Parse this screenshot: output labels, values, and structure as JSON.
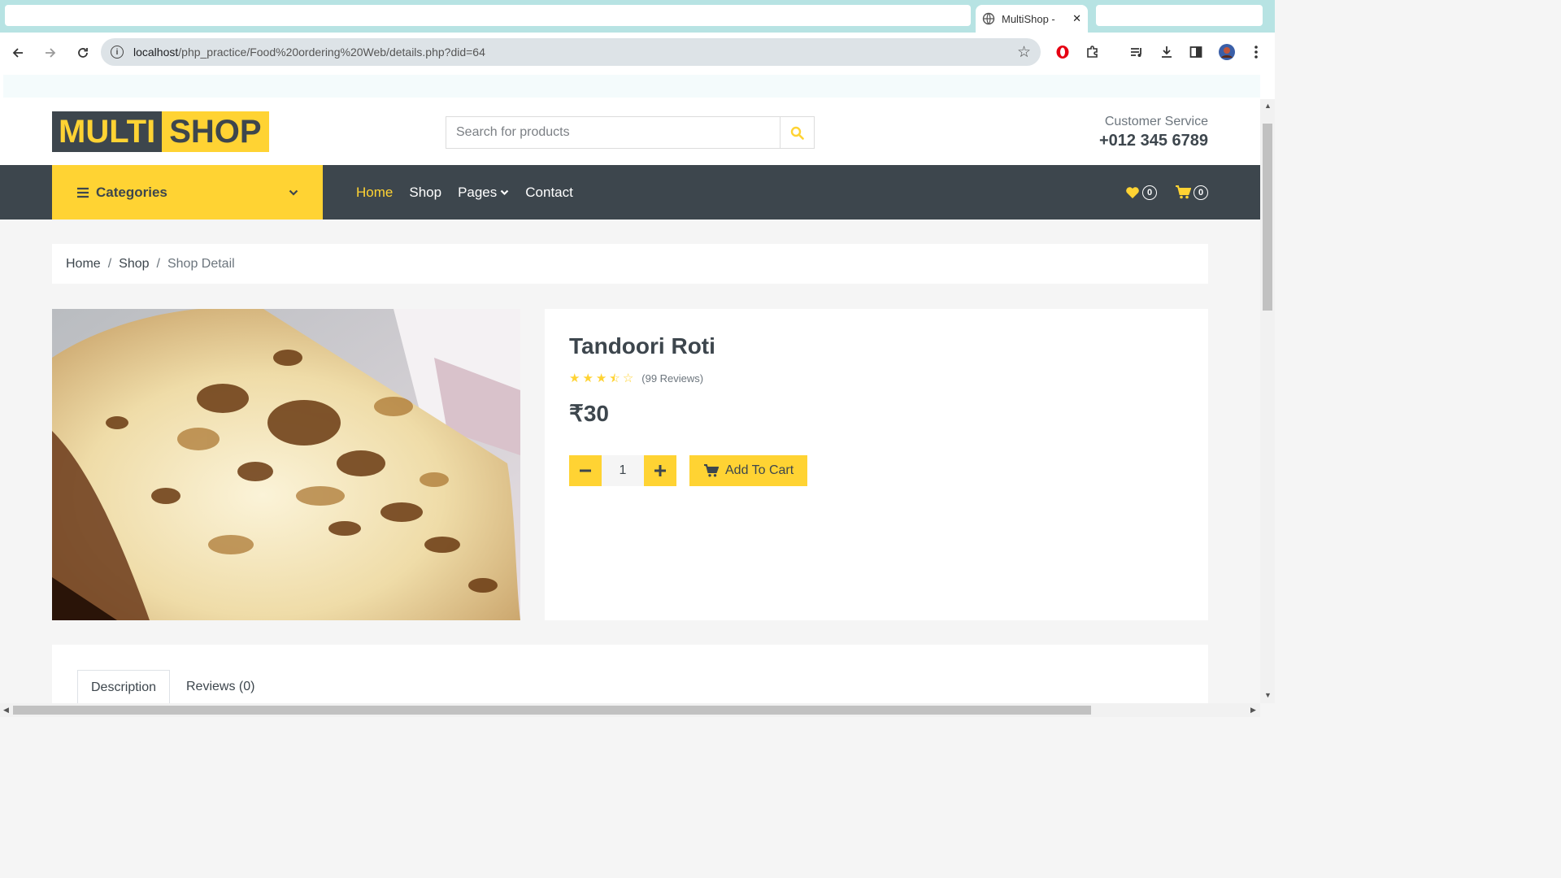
{
  "browser": {
    "tab_title": "MultiShop - ",
    "tab_close": "✕",
    "url_host": "localhost",
    "url_path": "/php_practice/Food%20ordering%20Web/details.php?did=64"
  },
  "site": {
    "logo_part1": "MULTI",
    "logo_part2": "SHOP",
    "search_placeholder": "Search for products",
    "customer_service_label": "Customer Service",
    "customer_service_phone": "+012 345 6789"
  },
  "nav": {
    "categories_label": "Categories",
    "links": [
      "Home",
      "Shop",
      "Pages",
      "Contact"
    ],
    "active_link": "Home",
    "wishlist_count": "0",
    "cart_count": "0"
  },
  "breadcrumb": {
    "items": [
      "Home",
      "Shop"
    ],
    "current": "Shop Detail",
    "separator": "/"
  },
  "product": {
    "name": "Tandoori Roti",
    "rating": 3.5,
    "rating_max": 5,
    "reviews_text": "(99 Reviews)",
    "price": "₹30",
    "quantity": "1",
    "add_to_cart_label": "Add To Cart"
  },
  "tabs": {
    "description_label": "Description",
    "reviews_label": "Reviews (0)"
  },
  "colors": {
    "accent": "#ffd333",
    "dark": "#3d464d",
    "page_bg": "#f5f5f5"
  }
}
